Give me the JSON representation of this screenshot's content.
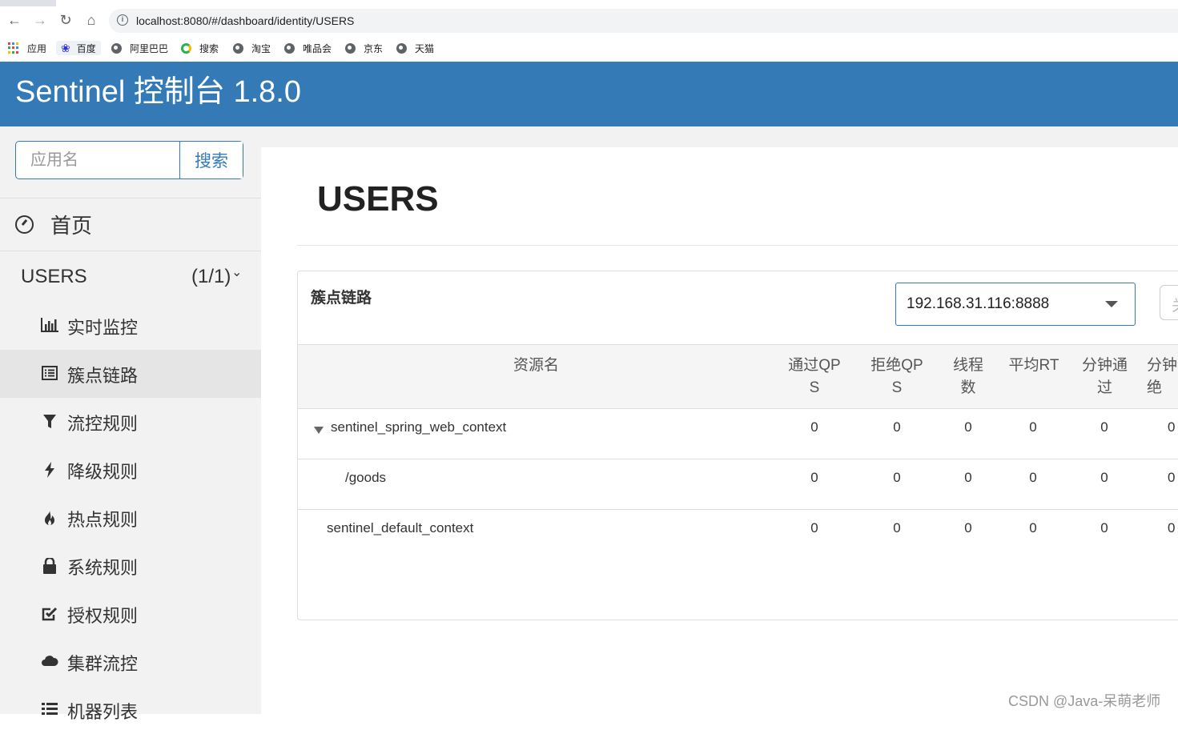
{
  "browser": {
    "url": "localhost:8080/#/dashboard/identity/USERS",
    "bookmarks": [
      "应用",
      "百度",
      "阿里巴巴",
      "搜索",
      "淘宝",
      "唯品会",
      "京东",
      "天猫"
    ]
  },
  "header": {
    "title": "Sentinel 控制台 1.8.0"
  },
  "sidebar": {
    "search_placeholder": "应用名",
    "search_button": "搜索",
    "home_label": "首页",
    "app": {
      "name": "USERS",
      "count": "(1/1)"
    },
    "menu": [
      {
        "label": "实时监控",
        "icon": "bar-chart-icon"
      },
      {
        "label": "簇点链路",
        "icon": "list-icon"
      },
      {
        "label": "流控规则",
        "icon": "filter-icon"
      },
      {
        "label": "降级规则",
        "icon": "flash-icon"
      },
      {
        "label": "热点规则",
        "icon": "fire-icon"
      },
      {
        "label": "系统规则",
        "icon": "lock-icon"
      },
      {
        "label": "授权规则",
        "icon": "check-icon"
      },
      {
        "label": "集群流控",
        "icon": "cloud-icon"
      },
      {
        "label": "机器列表",
        "icon": "list-alt-icon"
      }
    ],
    "active_index": 1
  },
  "main": {
    "page_title": "USERS",
    "panel_title": "簇点链路",
    "machine": "192.168.31.116:8888",
    "partial_button": "关",
    "columns": [
      "资源名",
      "通过QP\nS",
      "拒绝QP\nS",
      "线程\n数",
      "平均RT",
      "分钟通\n过",
      "分钟\n绝"
    ],
    "rows": [
      {
        "name": "sentinel_spring_web_context",
        "values": [
          "0",
          "0",
          "0",
          "0",
          "0",
          "0"
        ]
      },
      {
        "name": "/goods",
        "values": [
          "0",
          "0",
          "0",
          "0",
          "0",
          "0"
        ]
      },
      {
        "name": "sentinel_default_context",
        "values": [
          "0",
          "0",
          "0",
          "0",
          "0",
          "0"
        ]
      }
    ]
  },
  "watermark": "CSDN @Java-呆萌老师",
  "colors": {
    "primary": "#337ab7",
    "sidebar_bg": "#f2f2f2",
    "active_bg": "#e5e5e5"
  }
}
